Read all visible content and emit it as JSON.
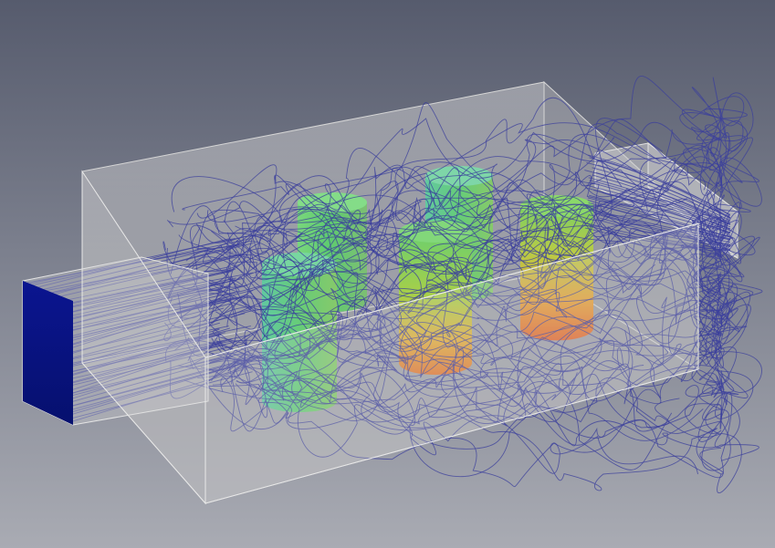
{
  "view": {
    "background_top": "#565b6d",
    "background_bottom": "#a9abb3"
  },
  "scene": {
    "domain_box_color": "#c4c4c4",
    "streamline_color": "#3b3f9c",
    "inlet_color": "#0a1287",
    "cylinders": [
      {
        "id": "front-left",
        "temperature_level": 0.25
      },
      {
        "id": "back-left",
        "temperature_level": 0.2
      },
      {
        "id": "front-middle",
        "temperature_level": 0.75
      },
      {
        "id": "back-middle",
        "temperature_level": 0.3
      },
      {
        "id": "front-right",
        "temperature_level": 0.8
      }
    ],
    "colormap": [
      "#55c86a",
      "#a4d24a",
      "#e0a83e",
      "#e06a34"
    ]
  }
}
